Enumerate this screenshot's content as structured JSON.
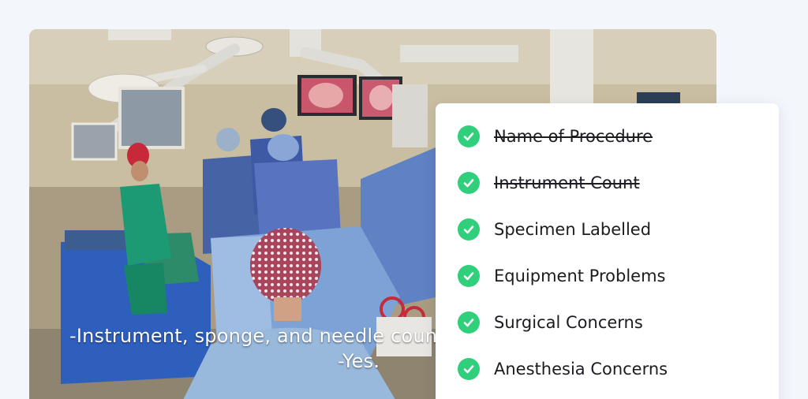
{
  "video": {
    "caption_lines": [
      "-Instrument, sponge, and needle coun",
      "-Yes."
    ]
  },
  "checklist": {
    "accent_color": "#2fcf7c",
    "items": [
      {
        "label": "Name of Procedure",
        "checked": true,
        "struck": true,
        "icon": "check-circle-icon"
      },
      {
        "label": "Instrument Count",
        "checked": true,
        "struck": true,
        "icon": "check-circle-icon"
      },
      {
        "label": "Specimen Labelled",
        "checked": true,
        "struck": false,
        "icon": "check-circle-icon"
      },
      {
        "label": "Equipment Problems",
        "checked": true,
        "struck": false,
        "icon": "check-circle-icon"
      },
      {
        "label": "Surgical Concerns",
        "checked": true,
        "struck": false,
        "icon": "check-circle-icon"
      },
      {
        "label": "Anesthesia Concerns",
        "checked": true,
        "struck": false,
        "icon": "check-circle-icon"
      }
    ]
  }
}
